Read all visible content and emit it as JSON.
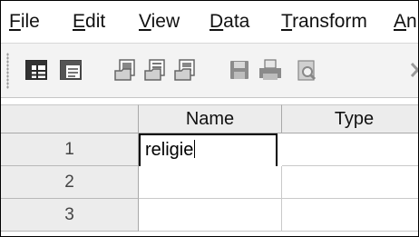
{
  "menu": {
    "items": [
      {
        "key": "file",
        "accel": "F",
        "rest": "ile"
      },
      {
        "key": "edit",
        "accel": "E",
        "rest": "dit"
      },
      {
        "key": "view",
        "accel": "V",
        "rest": "iew"
      },
      {
        "key": "data",
        "accel": "D",
        "rest": "ata"
      },
      {
        "key": "transform",
        "accel": "T",
        "rest": "ransform"
      },
      {
        "key": "analyze",
        "accel": "A",
        "rest": "n"
      }
    ]
  },
  "toolbar": {
    "icons": [
      "data-view-icon",
      "variable-view-icon",
      "open-data-icon",
      "open-syntax-icon",
      "open-output-icon",
      "save-icon",
      "print-icon",
      "print-preview-icon",
      "close-icon"
    ]
  },
  "grid": {
    "columns": [
      "",
      "Name",
      "Type"
    ],
    "rows": [
      {
        "num": "1",
        "name": "religie",
        "type": ""
      },
      {
        "num": "2",
        "name": "",
        "type": ""
      },
      {
        "num": "3",
        "name": "",
        "type": ""
      }
    ],
    "active_cell_value": "religie"
  }
}
